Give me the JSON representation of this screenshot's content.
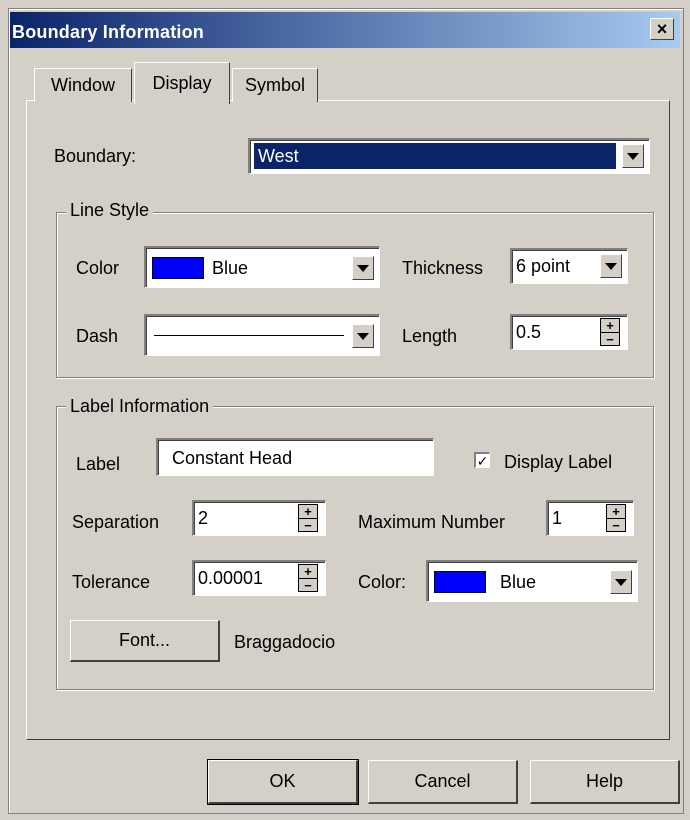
{
  "window": {
    "title": "Boundary Information",
    "close_glyph": "×"
  },
  "tabs": [
    {
      "label": "Window"
    },
    {
      "label": "Display"
    },
    {
      "label": "Symbol"
    }
  ],
  "boundary": {
    "label": "Boundary:",
    "value": "West"
  },
  "line_style": {
    "legend": "Line Style",
    "color_label": "Color",
    "color_value": "Blue",
    "color_swatch": "#0000ff",
    "thickness_label": "Thickness",
    "thickness_value": "6 point",
    "dash_label": "Dash",
    "length_label": "Length",
    "length_value": "0.5"
  },
  "label_info": {
    "legend": "Label Information",
    "label_label": "Label",
    "label_value": "Constant Head",
    "display_label": "Display Label",
    "display_checked": true,
    "separation_label": "Separation",
    "separation_value": "2",
    "max_number_label": "Maximum Number",
    "max_number_value": "1",
    "tolerance_label": "Tolerance",
    "tolerance_value": "0.00001",
    "color_label": "Color:",
    "color_value": "Blue",
    "color_swatch": "#0000ff",
    "font_button": "Font...",
    "font_name": "Braggadocio"
  },
  "buttons": {
    "ok": "OK",
    "cancel": "Cancel",
    "help": "Help"
  },
  "colors": {
    "titlebar_start": "#0a246a",
    "titlebar_end": "#a6caf0",
    "selection": "#0a246a",
    "face": "#d4d0c8"
  }
}
